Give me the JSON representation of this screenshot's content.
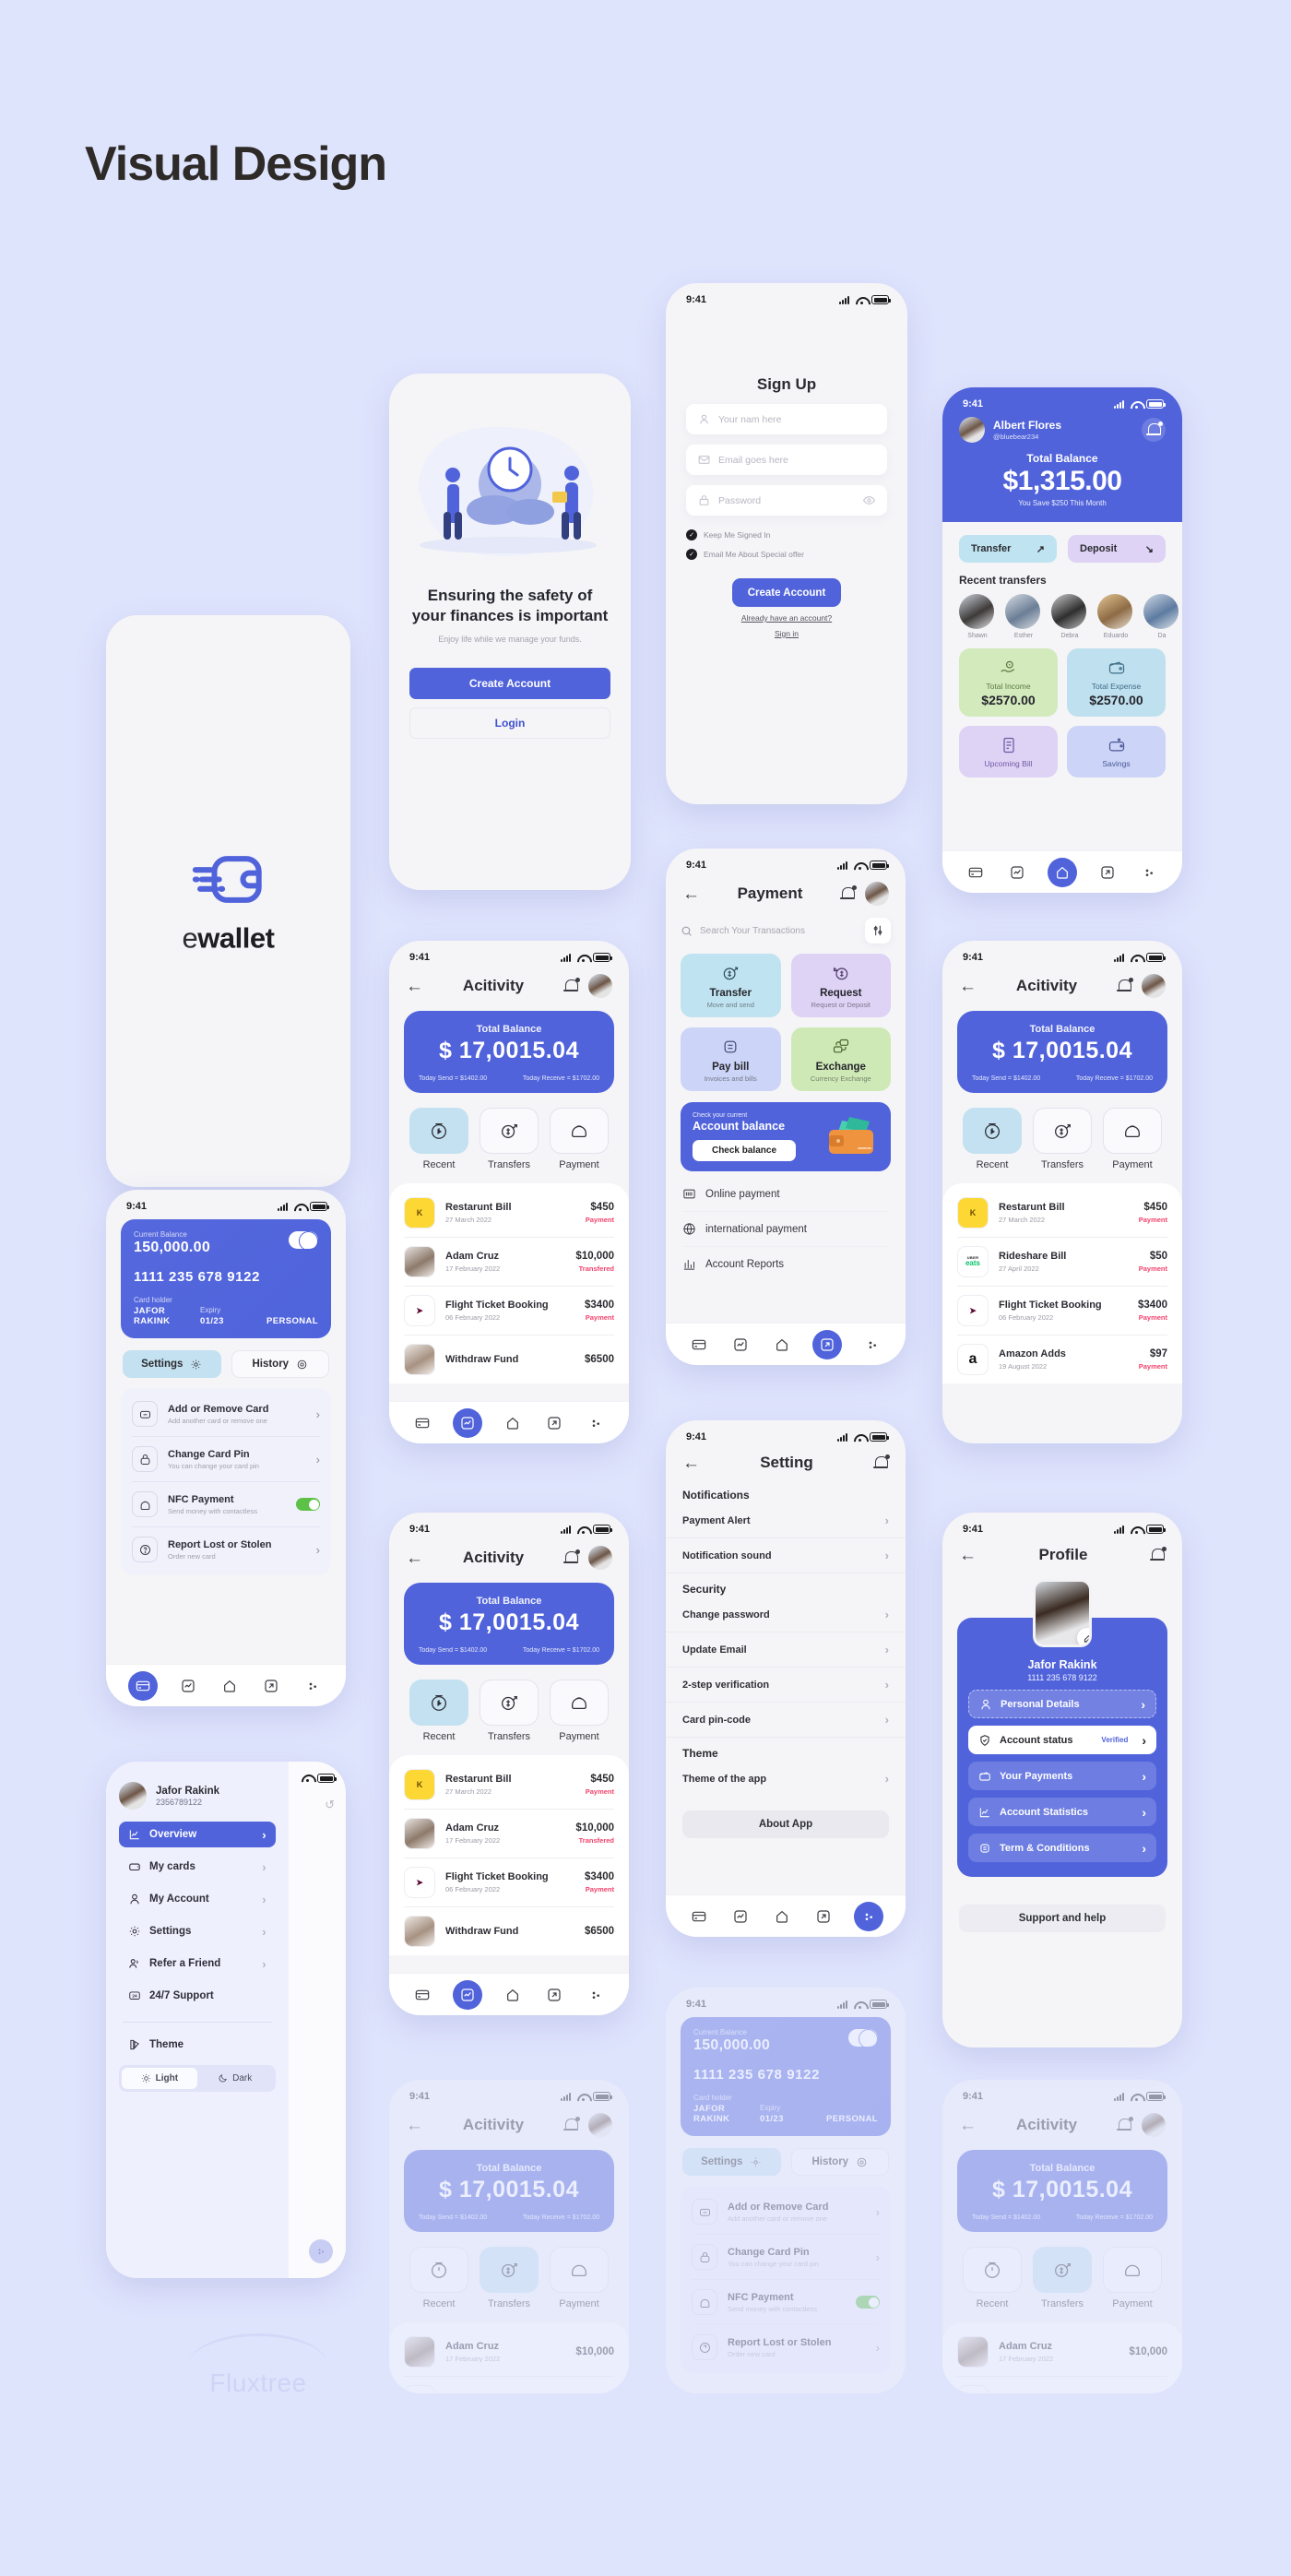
{
  "page": {
    "title": "Visual Design",
    "watermark": "Fluxtree"
  },
  "status_bar": {
    "time": "9:41"
  },
  "brand": {
    "accent": "#5063db",
    "logo_text_light": "e",
    "logo_text_bold": "wallet",
    "logo_icon": "wallet-motion-icon"
  },
  "screens": {
    "splash": {
      "name": "splash-screen"
    },
    "onboarding": {
      "heading_line1": "Ensuring the safety of",
      "heading_line2": "your finances is important",
      "subtitle": "Enjoy life while we manage your funds.",
      "primary_button": "Create Account",
      "secondary_button": "Login"
    },
    "signup": {
      "title": "Sign Up",
      "fields": [
        {
          "icon": "user-icon",
          "placeholder": "Your nam here"
        },
        {
          "icon": "envelope-icon",
          "placeholder": "Email goes here"
        },
        {
          "icon": "lock-icon",
          "placeholder": "Password",
          "trailing_icon": "eye-icon"
        }
      ],
      "checkboxes": [
        "Keep Me Signed In",
        "Email Me About Special offer"
      ],
      "submit": "Create Account",
      "link_line1": "Already have an account?",
      "link_line2": "Sign in"
    },
    "home": {
      "user_name": "Albert Flores",
      "user_handle": "@bluebear234",
      "balance_label": "Total Balance",
      "balance": "$1,315.00",
      "savings_note": "You Save $250 This Month",
      "actions": [
        {
          "label": "Transfer",
          "icon": "arrow-up-right-icon",
          "color": "#bfe3f0"
        },
        {
          "label": "Deposit",
          "icon": "arrow-down-right-icon",
          "color": "#ded2f5"
        }
      ],
      "recent_heading": "Recent transfers",
      "people": [
        "Shawn",
        "Esther",
        "Debra",
        "Eduardo",
        "Da"
      ],
      "stats": [
        {
          "label": "Total Income",
          "value": "$2570.00",
          "icon": "hand-coin-icon",
          "color": "#d3eabd"
        },
        {
          "label": "Total Expense",
          "value": "$2570.00",
          "icon": "wallet-icon",
          "color": "#bfe0ef"
        },
        {
          "label": "Upcoming Bill",
          "value": "",
          "icon": "receipt-icon",
          "color": "#ded2f5"
        },
        {
          "label": "Savings",
          "value": "",
          "icon": "piggy-wallet-icon",
          "color": "#ccd4f7"
        }
      ]
    },
    "activity": {
      "title": "Acitivity",
      "balance_label": "Total Balance",
      "balance": "$ 17,0015.04",
      "today_send": "Today Send = $1402.00",
      "today_receive": "Today Receive = $1702.00",
      "tabs": [
        {
          "label": "Recent",
          "icon": "clock-play-icon",
          "active": true
        },
        {
          "label": "Transfers",
          "icon": "dollar-arrow-icon",
          "active": false
        },
        {
          "label": "Payment",
          "icon": "wallet-pouch-icon",
          "active": false
        }
      ],
      "transactions_a": [
        {
          "logo": "kitchen-logo",
          "name": "Restarunt Bill",
          "date": "27 March 2022",
          "amount": "$450",
          "type": "Payment"
        },
        {
          "logo": "person-photo",
          "name": "Adam Cruz",
          "date": "17 February 2022",
          "amount": "$10,000",
          "type": "Transfered"
        },
        {
          "logo": "qatar-airways-logo",
          "name": "Flight Ticket Booking",
          "date": "06 February 2022",
          "amount": "$3400",
          "type": "Payment"
        },
        {
          "logo": "person-photo",
          "name": "Withdraw Fund",
          "date": "",
          "amount": "$6500",
          "type": ""
        }
      ],
      "transactions_b": [
        {
          "logo": "kitchen-logo",
          "name": "Restarunt Bill",
          "date": "27 March 2022",
          "amount": "$450",
          "type": "Payment"
        },
        {
          "logo": "uber-eats-logo",
          "name": "Rideshare Bill",
          "date": "27 April 2022",
          "amount": "$50",
          "type": "Payment"
        },
        {
          "logo": "qatar-airways-logo",
          "name": "Flight Ticket Booking",
          "date": "06 February 2022",
          "amount": "$3400",
          "type": "Payment"
        },
        {
          "logo": "amazon-logo",
          "name": "Amazon Adds",
          "date": "19 August 2022",
          "amount": "$97",
          "type": "Payment"
        }
      ]
    },
    "payment": {
      "title": "Payment",
      "search_placeholder": "Search Your Transactions",
      "cards": [
        {
          "title": "Transfer",
          "sub": "Move and  send",
          "icon": "dollar-arrow-up-icon",
          "color": "#bfe3f0"
        },
        {
          "title": "Request",
          "sub": "Request or Deposit",
          "icon": "dollar-arrow-down-icon",
          "color": "#ded2f5"
        },
        {
          "title": "Pay bill",
          "sub": "Invoices and bills",
          "icon": "bill-icon",
          "color": "#ccd4f7"
        },
        {
          "title": "Exchange",
          "sub": "Currency Exchange",
          "icon": "exchange-cards-icon",
          "color": "#cfe9b6"
        }
      ],
      "banner_small": "Check your current",
      "banner_big": "Account balance",
      "banner_button": "Check balance",
      "links": [
        {
          "label": "Online payment",
          "icon": "barcode-icon"
        },
        {
          "label": "international payment",
          "icon": "globe-icon"
        },
        {
          "label": "Account Reports",
          "icon": "bar-chart-icon"
        }
      ]
    },
    "setting": {
      "title": "Setting",
      "groups": [
        {
          "heading": "Notifications",
          "items": [
            "Payment Alert",
            "Notification sound"
          ]
        },
        {
          "heading": "Security",
          "items": [
            "Change password",
            "Update Email",
            "2-step verification",
            "Card pin-code"
          ]
        },
        {
          "heading": "Theme",
          "items": [
            "Theme of the app"
          ]
        }
      ],
      "about_button": "About App"
    },
    "profile": {
      "title": "Profile",
      "name": "Jafor Rakink",
      "card_number": "1111 235 678 9122",
      "items": [
        {
          "label": "Personal Details",
          "icon": "user-icon",
          "badge": "",
          "style": "first"
        },
        {
          "label": "Account status",
          "icon": "shield-check-icon",
          "badge": "Verified",
          "style": "white"
        },
        {
          "label": "Your Payments",
          "icon": "wallet-icon",
          "badge": "",
          "style": ""
        },
        {
          "label": "Account Statistics",
          "icon": "chart-line-icon",
          "badge": "",
          "style": ""
        },
        {
          "label": "Term & Conditions",
          "icon": "document-icon",
          "badge": "",
          "style": ""
        }
      ],
      "support_button": "Support and help"
    },
    "card": {
      "balance_label": "Current Balance",
      "balance": "150,000.00",
      "number": "1111 235 678 9122",
      "holder_label": "Card holder",
      "holder": "JAFOR RAKINK",
      "expiry_label": "Expiry",
      "expiry": "01/23",
      "kind": "PERSONAL",
      "segments": [
        {
          "label": "Settings",
          "icon": "gear-icon",
          "active": true
        },
        {
          "label": "History",
          "icon": "history-icon",
          "active": false
        }
      ],
      "options": [
        {
          "title": "Add or Remove Card",
          "sub": "Add another card or remove one",
          "icon": "card-minus-icon",
          "control": "chevron"
        },
        {
          "title": "Change Card Pin",
          "sub": "You can change your card pin",
          "icon": "lock-icon",
          "control": "chevron"
        },
        {
          "title": "NFC Payment",
          "sub": "Send money with contactless",
          "icon": "wallet-pouch-icon",
          "control": "toggle-on"
        },
        {
          "title": "Report Lost or Stolen",
          "sub": "Order new card",
          "icon": "question-icon",
          "control": "chevron"
        }
      ]
    },
    "drawer": {
      "name": "Jafor Rakink",
      "number": "2356789122",
      "items": [
        {
          "label": "Overview",
          "icon": "chart-line-icon",
          "active": true
        },
        {
          "label": "My cards",
          "icon": "card-icon",
          "active": false
        },
        {
          "label": "My Account",
          "icon": "user-icon",
          "active": false
        },
        {
          "label": "Settings",
          "icon": "gear-icon",
          "active": false
        },
        {
          "label": "Refer a Friend",
          "icon": "users-icon",
          "active": false
        },
        {
          "label": "24/7 Support",
          "icon": "support-24-icon",
          "active": false
        }
      ],
      "theme_label": "Theme",
      "theme_options": [
        {
          "label": "Light",
          "icon": "sun-icon",
          "active": true
        },
        {
          "label": "Dark",
          "icon": "moon-icon",
          "active": false
        }
      ]
    }
  },
  "bottom_nav": [
    {
      "icon": "card-icon"
    },
    {
      "icon": "chart-icon"
    },
    {
      "icon": "home-icon"
    },
    {
      "icon": "send-icon"
    },
    {
      "icon": "more-icon"
    }
  ]
}
